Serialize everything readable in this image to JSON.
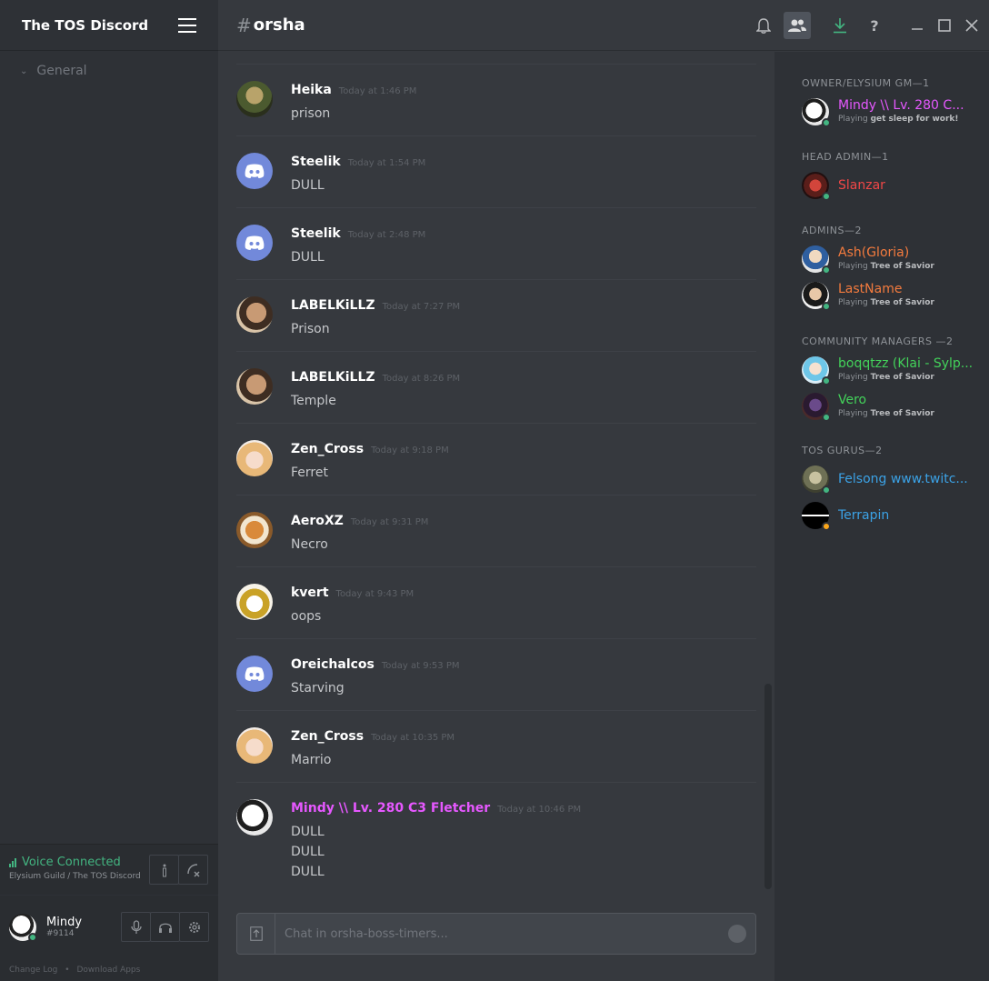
{
  "server": {
    "name": "The TOS Discord",
    "category": "General"
  },
  "voice": {
    "status": "Voice Connected",
    "location": "Elysium Guild / The TOS Discord",
    "color": "#43b581"
  },
  "user": {
    "name": "Mindy",
    "tag": "#9114"
  },
  "footer": {
    "change_log": "Change Log",
    "separator": "•",
    "download": "Download Apps"
  },
  "header": {
    "hash": "#",
    "channel": "orsha"
  },
  "messages": [
    {
      "author": "Heika",
      "time": "Today at 1:46 PM",
      "lines": [
        "prison"
      ],
      "color": "#ffffff"
    },
    {
      "author": "Steelik",
      "time": "Today at 1:54 PM",
      "lines": [
        "DULL"
      ],
      "color": "#ffffff"
    },
    {
      "author": "Steelik",
      "time": "Today at 2:48 PM",
      "lines": [
        "DULL"
      ],
      "color": "#ffffff"
    },
    {
      "author": "LABELKiLLZ",
      "time": "Today at 7:27 PM",
      "lines": [
        "Prison"
      ],
      "color": "#ffffff"
    },
    {
      "author": "LABELKiLLZ",
      "time": "Today at 8:26 PM",
      "lines": [
        "Temple"
      ],
      "color": "#ffffff"
    },
    {
      "author": "Zen_Cross",
      "time": "Today at 9:18 PM",
      "lines": [
        "Ferret"
      ],
      "color": "#ffffff"
    },
    {
      "author": "AeroXZ",
      "time": "Today at 9:31 PM",
      "lines": [
        "Necro"
      ],
      "color": "#ffffff"
    },
    {
      "author": "kvert",
      "time": "Today at 9:43 PM",
      "lines": [
        "oops"
      ],
      "color": "#ffffff"
    },
    {
      "author": "Oreichalcos",
      "time": "Today at 9:53 PM",
      "lines": [
        "Starving"
      ],
      "color": "#ffffff"
    },
    {
      "author": "Zen_Cross",
      "time": "Today at 10:35 PM",
      "lines": [
        "Marrio"
      ],
      "color": "#ffffff"
    },
    {
      "author": "Mindy \\\\ Lv. 280 C3 Fletcher",
      "time": "Today at 10:46 PM",
      "lines": [
        "DULL",
        "DULL",
        "DULL"
      ],
      "color": "#e658ff"
    }
  ],
  "input": {
    "placeholder": "Chat in orsha-boss-timers..."
  },
  "members": {
    "playing_prefix": "Playing",
    "groups": [
      {
        "role": "OWNER/ELYSIUM GM—1",
        "members": [
          {
            "name": "Mindy \\\\ Lv. 280 C...",
            "game": "get sleep for work!",
            "color": "#e658ff",
            "status": "#43b581"
          }
        ]
      },
      {
        "role": "HEAD ADMIN—1",
        "members": [
          {
            "name": "Slanzar",
            "game": "",
            "color": "#f04747",
            "status": "#43b581"
          }
        ]
      },
      {
        "role": "ADMINS—2",
        "members": [
          {
            "name": "Ash(Gloria)",
            "game": "Tree of Savior",
            "color": "#f47b3e",
            "status": "#43b581"
          },
          {
            "name": "LastName",
            "game": "Tree of Savior",
            "color": "#f47b3e",
            "status": "#43b581"
          }
        ]
      },
      {
        "role": "COMMUNITY MANAGERS —2",
        "members": [
          {
            "name": "boqqtzz (Klai - Sylp...",
            "game": "Tree of Savior",
            "color": "#43d25a",
            "status": "#43b581"
          },
          {
            "name": "Vero",
            "game": "Tree of Savior",
            "color": "#43d25a",
            "status": "#43b581"
          }
        ]
      },
      {
        "role": "TOS GURUS—2",
        "members": [
          {
            "name": "Felsong www.twitc...",
            "game": "",
            "color": "#3ba2e6",
            "status": "#43b581"
          },
          {
            "name": "Terrapin",
            "game": "",
            "color": "#3ba2e6",
            "status": "#faa61a"
          }
        ]
      }
    ]
  }
}
